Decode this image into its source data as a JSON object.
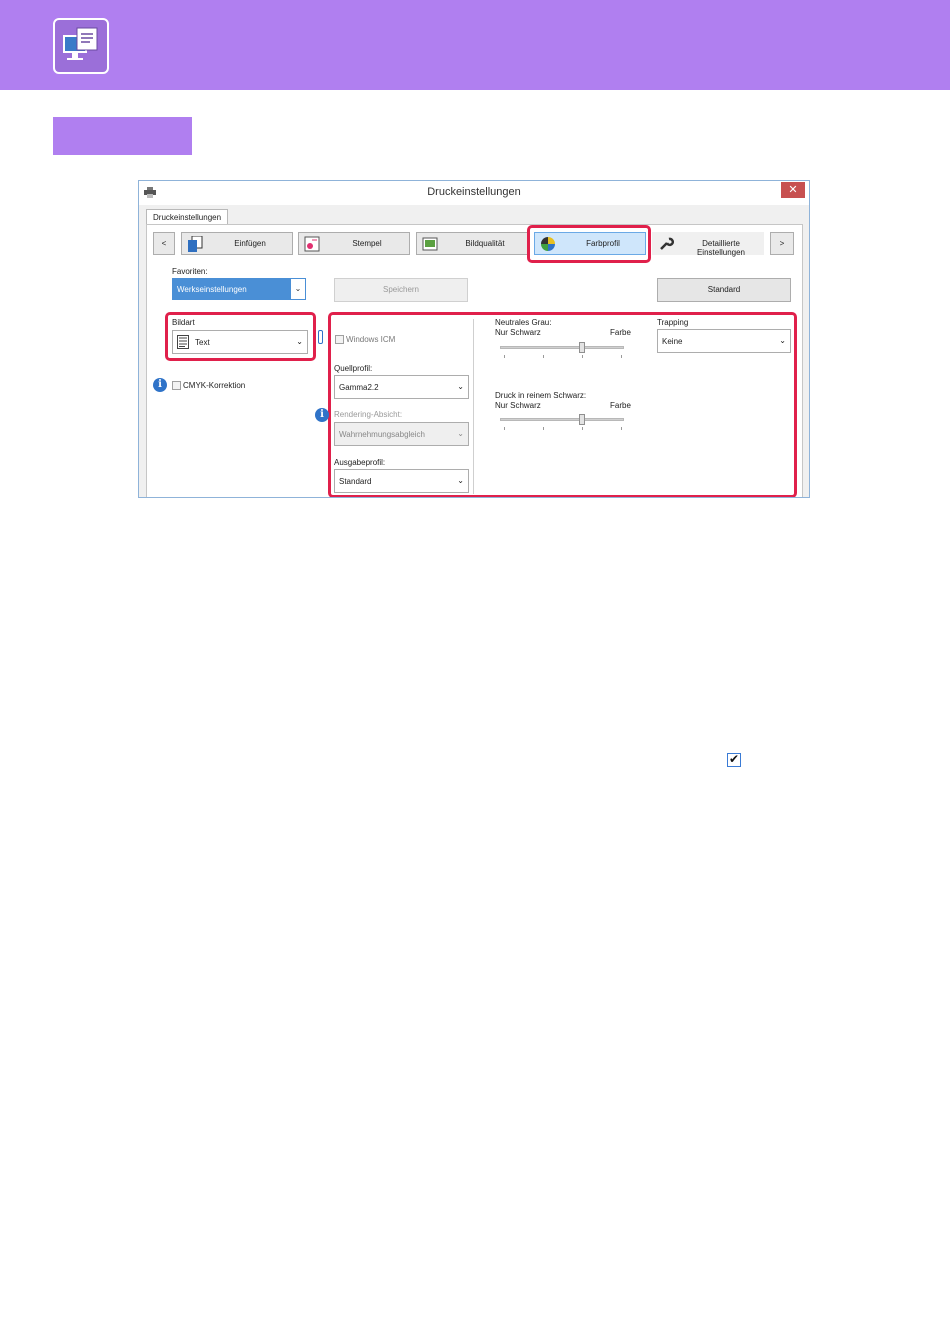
{
  "colors": {
    "header_bg": "#b07ff0",
    "highlight": "#e0204b",
    "accent": "#4a8fd6"
  },
  "header": {
    "icon": "printer-computer-icon"
  },
  "dialog": {
    "title": "Druckeinstellungen",
    "close_symbol": "✕",
    "tab_label": "Druckeinstellungen",
    "nav": {
      "prev": "<",
      "next": ">",
      "buttons": [
        {
          "label": "Einfügen",
          "icon": "insert-icon"
        },
        {
          "label": "Stempel",
          "icon": "stamp-icon"
        },
        {
          "label": "Bildqualität",
          "icon": "image-quality-icon"
        },
        {
          "label": "Farbprofil",
          "icon": "color-profile-icon",
          "active": true
        },
        {
          "label": "Detaillierte Einstellungen",
          "icon": "wrench-icon"
        }
      ]
    },
    "favorites": {
      "label": "Favoriten:",
      "value": "Werkseinstellungen",
      "save": "Speichern",
      "standard": "Standard"
    },
    "bildart": {
      "label": "Bildart",
      "value": "Text",
      "icon": "document-text-icon"
    },
    "cmyk": {
      "label": "CMYK-Korrektion",
      "checked": false
    },
    "windows_icm": {
      "label": "Windows ICM",
      "checked": false
    },
    "quellprofil": {
      "label": "Quellprofil:",
      "value": "Gamma2.2"
    },
    "rendering": {
      "label": "Rendering-Absicht:",
      "value": "Wahrnehmungsabgleich"
    },
    "ausgabeprofil": {
      "label": "Ausgabeprofil:",
      "value": "Standard"
    },
    "neutral_grau": {
      "label": "Neutrales Grau:",
      "left": "Nur Schwarz",
      "right": "Farbe",
      "level": 0.66
    },
    "reines_schwarz": {
      "label": "Druck in reinem Schwarz:",
      "left": "Nur Schwarz",
      "right": "Farbe",
      "level": 0.66
    },
    "trapping": {
      "label": "Trapping",
      "value": "Keine"
    }
  },
  "checkmark": "✔"
}
